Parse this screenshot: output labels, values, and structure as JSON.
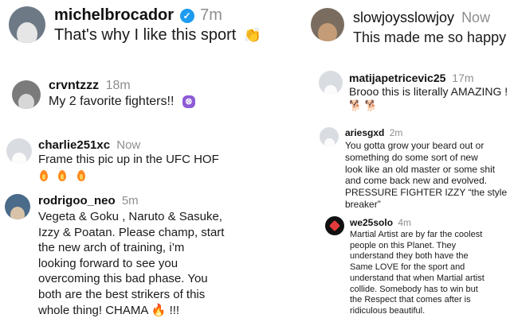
{
  "left": [
    {
      "user": "michelbrocador",
      "verified": true,
      "time": "7m",
      "text": "That's why I like this sport",
      "emoji": "👏",
      "avatar": "photo"
    },
    {
      "user": "crvntzzz",
      "verified": false,
      "time": "18m",
      "text": "My 2 favorite fighters!!",
      "emoji": "eggplant-badge",
      "avatar": "bw"
    },
    {
      "user": "charlie251xc",
      "verified": false,
      "time": "Now",
      "text": "Frame this pic up in the UFC HOF",
      "emoji": "🔥 🔥 🔥",
      "avatar": "default"
    },
    {
      "user": "rodrigoo_neo",
      "verified": false,
      "time": "5m",
      "text_lines": [
        "Vegeta & Goku , Naruto & Sasuke,",
        "Izzy & Poatan. Please champ, start",
        "the new arch of training, i’m",
        "looking forward to see you",
        "overcoming this bad phase. You",
        "both are the best strikers of this",
        "whole thing! CHAMA 🔥 !!!"
      ],
      "avatar": "photo"
    }
  ],
  "right": [
    {
      "user": "slowjoysslowjoy",
      "verified": false,
      "time": "Now",
      "text": "This made me so happy",
      "avatar": "photo"
    },
    {
      "user": "matijapetricevic25",
      "verified": false,
      "time": "17m",
      "text": "Brooo this is literally AMAZING !",
      "emoji": "🐕 🐕",
      "avatar": "default"
    },
    {
      "user": "ariesgxd",
      "verified": false,
      "time": "2m",
      "text_lines": [
        "You gotta grow your beard out or",
        "something do some sort of new",
        "look like an old master or some shit",
        "and come back new and evolved.",
        "PRESSURE FIGHTER IZZY “the style",
        "breaker”"
      ],
      "avatar": "default"
    },
    {
      "user": "we25solo",
      "verified": false,
      "time": "4m",
      "text_lines": [
        "Martial Artist are by far the coolest",
        "people on this Planet. They",
        "understand they both have the",
        "Same LOVE for the sport and",
        "understand that when Martial artist",
        "collide. Somebody has to win but",
        "the Respect that comes after is",
        "ridiculous beautiful."
      ],
      "avatar": "logo"
    }
  ]
}
